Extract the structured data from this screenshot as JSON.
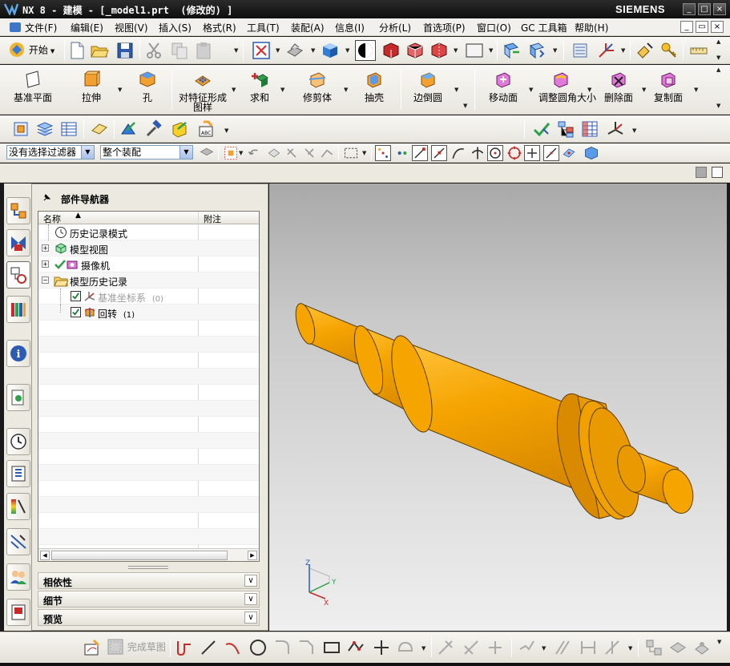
{
  "window": {
    "title": "NX 8 - 建模 - [_model1.prt  (修改的) ]",
    "brand": "SIEMENS",
    "controls": [
      "_",
      "□",
      "×"
    ]
  },
  "menu": {
    "items": [
      "文件(F)",
      "编辑(E)",
      "视图(V)",
      "插入(S)",
      "格式(R)",
      "工具(T)",
      "装配(A)",
      "信息(I)",
      "分析(L)",
      "首选项(P)",
      "窗口(O)",
      "GC 工具箱",
      "帮助(H)"
    ],
    "mdi_controls": [
      "_",
      "▭",
      "×"
    ]
  },
  "standard_toolbar": {
    "start_label": "开始"
  },
  "feature_toolbar": {
    "buttons": [
      "基准平面",
      "拉伸",
      "孔",
      "对特征形成图样",
      "求和",
      "修剪体",
      "抽壳",
      "边倒圆",
      "移动面",
      "调整圆角大小",
      "删除面",
      "复制面"
    ]
  },
  "selection_bar": {
    "filter_value": "没有选择过滤器",
    "scope_value": "整个装配"
  },
  "navigator": {
    "title": "部件导航器",
    "columns": [
      "名称",
      "附注"
    ],
    "rows": [
      {
        "label": "历史记录模式",
        "icon": "clock-icon"
      },
      {
        "label": "模型视图",
        "icon": "model-views-icon"
      },
      {
        "label": "摄像机",
        "icon": "camera-icon"
      },
      {
        "label": "模型历史记录",
        "icon": "folder-icon"
      },
      {
        "label": "基准坐标系",
        "suffix": "(0)",
        "icon": "datum-csys-icon"
      },
      {
        "label": "回转",
        "suffix": "(1)",
        "icon": "revolve-icon"
      }
    ],
    "sections": [
      "相依性",
      "细节",
      "预览"
    ]
  },
  "bottom_toolbar": {
    "finish_sketch_label": "完成草图"
  },
  "triad": {
    "x": "X",
    "y": "Y",
    "z": "Z"
  },
  "colors": {
    "part_fill": "#f5a400",
    "part_shade": "#d98a00",
    "title_bar": "#1a1a1a",
    "menu_bar": "#f1f0ec"
  }
}
